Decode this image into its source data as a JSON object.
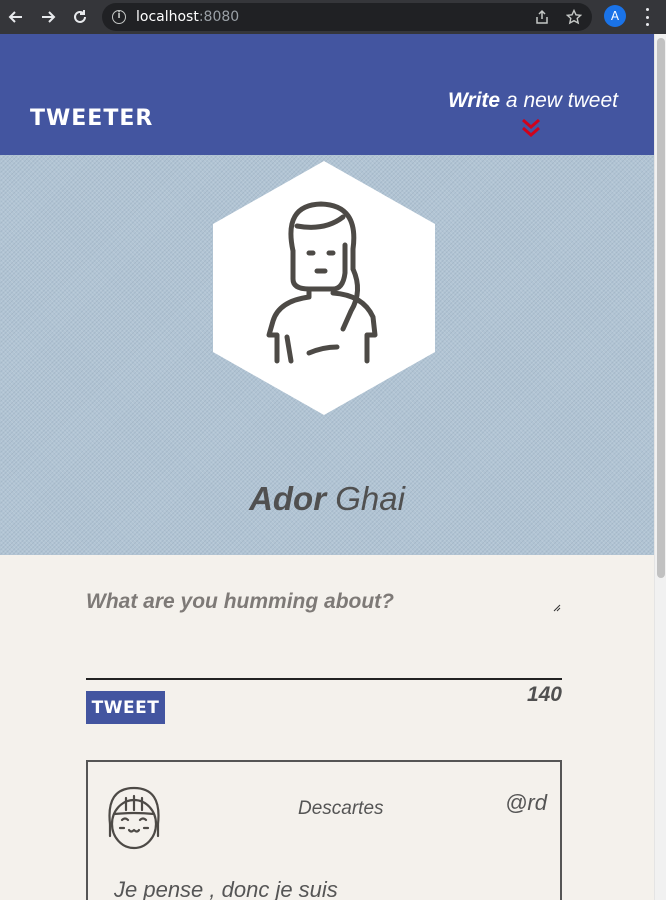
{
  "browser": {
    "url_host": "localhost",
    "url_port": ":8080",
    "profile_initial": "A",
    "icons": [
      "back-arrow-icon",
      "forward-arrow-icon",
      "reload-icon",
      "info-icon",
      "share-icon",
      "star-icon",
      "more-vert-icon"
    ]
  },
  "header": {
    "brand": "TWEETER",
    "write_bold": "Write",
    "write_rest": " a new tweet",
    "accent_color": "#d0021b",
    "bg_color": "#4355a0"
  },
  "profile": {
    "first_name": "Ador",
    "last_name": " Ghai",
    "avatar": "woman-avatar-icon",
    "bg_color": "#b1c4d4"
  },
  "compose": {
    "prompt": "What are you humming about?",
    "textarea_value": "",
    "button_label": "TWEET",
    "char_count": "140"
  },
  "tweets": [
    {
      "author": "Descartes",
      "handle": "@rd",
      "text": "Je pense , donc je suis",
      "avatar": "girl-avatar-icon"
    }
  ]
}
